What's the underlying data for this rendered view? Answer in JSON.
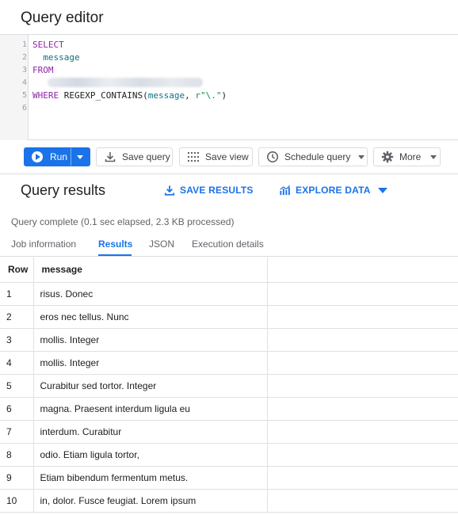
{
  "header": {
    "title": "Query editor"
  },
  "editor": {
    "line_numbers": [
      "1",
      "2",
      "3",
      "4",
      "5",
      "6"
    ],
    "lines": {
      "l1_kw": "SELECT",
      "l2_id": "message",
      "l3_kw": "FROM",
      "l5_kw": "WHERE",
      "l5_fn": "REGEXP_CONTAINS(",
      "l5_id": "message",
      "l5_sep": ", ",
      "l5_str": "r\"\\.\"",
      "l5_close": ")"
    }
  },
  "toolbar": {
    "run_label": "Run",
    "save_query_label": "Save query",
    "save_view_label": "Save view",
    "schedule_query_label": "Schedule query",
    "more_label": "More"
  },
  "results_header": {
    "title": "Query results",
    "save_results_label": "SAVE RESULTS",
    "explore_data_label": "EXPLORE DATA"
  },
  "status": "Query complete (0.1 sec elapsed, 2.3 KB processed)",
  "tabs": [
    {
      "label": "Job information"
    },
    {
      "label": "Results"
    },
    {
      "label": "JSON"
    },
    {
      "label": "Execution details"
    }
  ],
  "table": {
    "columns": [
      "Row",
      "message"
    ],
    "rows": [
      {
        "row": "1",
        "message": "risus. Donec"
      },
      {
        "row": "2",
        "message": "eros nec tellus. Nunc"
      },
      {
        "row": "3",
        "message": "mollis. Integer"
      },
      {
        "row": "4",
        "message": "mollis. Integer"
      },
      {
        "row": "5",
        "message": "Curabitur sed tortor. Integer"
      },
      {
        "row": "6",
        "message": "magna. Praesent interdum ligula eu"
      },
      {
        "row": "7",
        "message": "interdum. Curabitur"
      },
      {
        "row": "8",
        "message": "odio. Etiam ligula tortor,"
      },
      {
        "row": "9",
        "message": "Etiam bibendum fermentum metus."
      },
      {
        "row": "10",
        "message": "in, dolor. Fusce feugiat. Lorem ipsum"
      }
    ]
  },
  "colors": {
    "accent": "#1a73e8",
    "keyword": "#8e24aa",
    "identifier": "#0b7285",
    "string": "#0d904f"
  },
  "icons": [
    "play-icon",
    "chevron-down-icon",
    "download-icon",
    "view-grid-icon",
    "clock-icon",
    "gear-icon",
    "chart-icon"
  ]
}
